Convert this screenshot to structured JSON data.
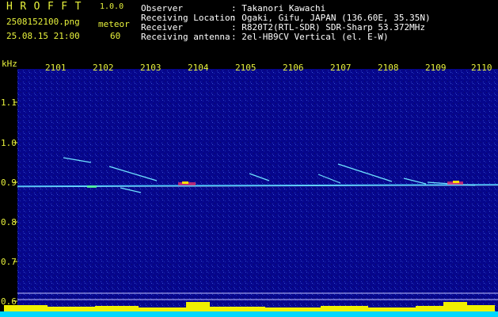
{
  "app": {
    "logo": "HROFFT",
    "version": "1.0.0"
  },
  "file": {
    "name": "2508152100.png",
    "datetime": "25.08.15 21:00"
  },
  "meteor": {
    "label": "meteor",
    "count": "60"
  },
  "info": [
    {
      "key": "Observer",
      "value": ": Takanori Kawachi"
    },
    {
      "key": "Receiving Location",
      "value": ": Ogaki, Gifu, JAPAN (136.60E, 35.35N)"
    },
    {
      "key": "Receiver",
      "value": ": R820T2(RTL-SDR) SDR-Sharp 53.372MHz"
    },
    {
      "key": "Receiving antenna",
      "value": ": 2el-HB9CV Vertical (el. E-W)"
    }
  ],
  "axis": {
    "unit": "kHz",
    "time_ticks": [
      "2101",
      "2102",
      "2103",
      "2104",
      "2105",
      "2106",
      "2107",
      "2108",
      "2109",
      "2110"
    ],
    "freq_ticks": [
      "1.1",
      "1.0",
      "0.9",
      "0.8",
      "0.7",
      "0.6"
    ]
  },
  "colors": {
    "header_text": "#e8f23c",
    "info_text": "#ffffff",
    "background": "#000080",
    "carrier": "#4fd0ff",
    "level_bar": "#f0f000"
  }
}
